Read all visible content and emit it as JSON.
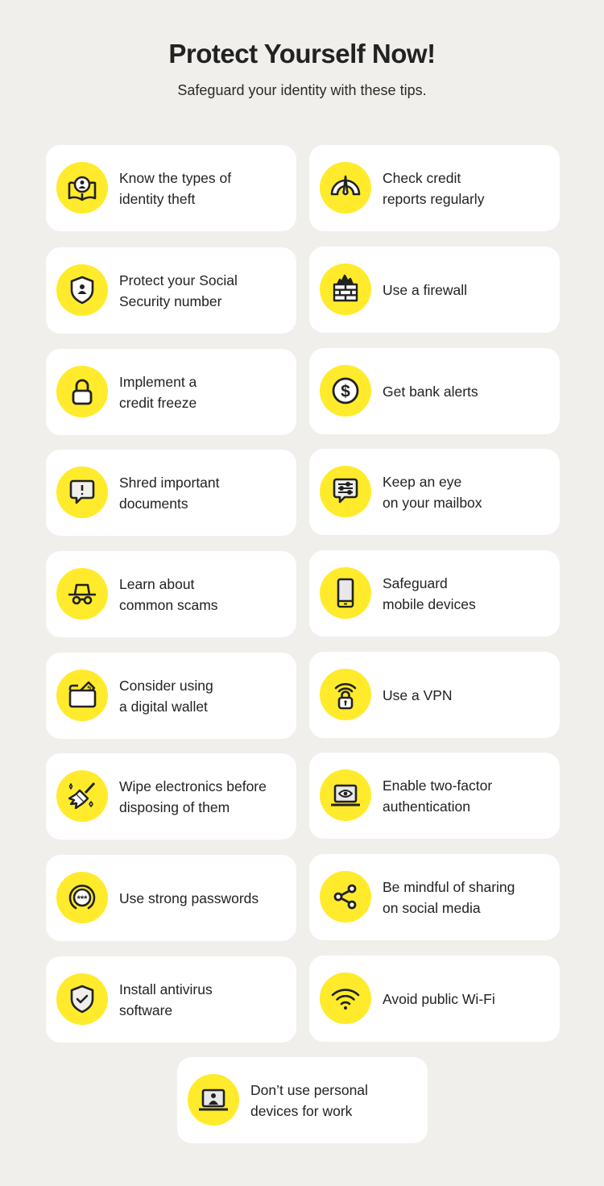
{
  "header": {
    "title": "Protect Yourself Now!",
    "subtitle": "Safeguard your identity with these tips."
  },
  "colors": {
    "background": "#f0efeb",
    "card": "#ffffff",
    "icon_circle": "#ffeb2b",
    "icon_stroke": "#222222",
    "text": "#222222"
  },
  "tips": [
    {
      "label": "Know the types of\nidentity theft",
      "icon": "book-person-icon"
    },
    {
      "label": "Check credit\nreports regularly",
      "icon": "gauge-icon"
    },
    {
      "label": "Protect your Social\nSecurity number",
      "icon": "shield-person-icon"
    },
    {
      "label": "Use a firewall",
      "icon": "firewall-icon"
    },
    {
      "label": "Implement a\ncredit freeze",
      "icon": "lock-icon"
    },
    {
      "label": "Get bank alerts",
      "icon": "dollar-coin-icon"
    },
    {
      "label": "Shred important\ndocuments",
      "icon": "alert-message-icon"
    },
    {
      "label": "Keep an eye\non your mailbox",
      "icon": "message-sliders-icon"
    },
    {
      "label": "Learn about\ncommon scams",
      "icon": "spy-icon"
    },
    {
      "label": "Safeguard\nmobile devices",
      "icon": "smartphone-icon"
    },
    {
      "label": "Consider using\na digital wallet",
      "icon": "wallet-icon"
    },
    {
      "label": "Use a VPN",
      "icon": "wifi-lock-icon"
    },
    {
      "label": "Wipe electronics before\ndisposing of them",
      "icon": "broom-icon"
    },
    {
      "label": "Enable two-factor\nauthentication",
      "icon": "laptop-eye-icon"
    },
    {
      "label": "Use strong passwords",
      "icon": "password-icon"
    },
    {
      "label": "Be mindful of sharing\non social media",
      "icon": "share-icon"
    },
    {
      "label": "Install antivirus\nsoftware",
      "icon": "shield-check-icon"
    },
    {
      "label": "Avoid public Wi-Fi",
      "icon": "wifi-icon"
    },
    {
      "label": "Don’t use personal\ndevices for work",
      "icon": "laptop-person-icon"
    }
  ]
}
